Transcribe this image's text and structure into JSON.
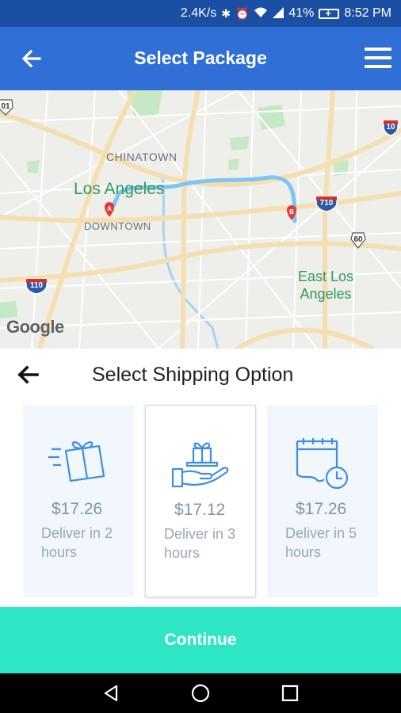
{
  "status_bar": {
    "speed": "2.4K/s",
    "battery_percent": "41%",
    "time": "8:52 PM",
    "icons": [
      "bluetooth-icon",
      "alarm-icon",
      "wifi-icon",
      "signal-icon",
      "battery-charging-icon"
    ]
  },
  "app_bar": {
    "title": "Select Package",
    "back_icon": "arrow-left-icon",
    "menu_icon": "hamburger-menu-icon"
  },
  "map": {
    "labels": {
      "chinatown": "CHINATOWN",
      "los_angeles": "Los Angeles",
      "downtown": "DOWNTOWN",
      "east_la_line1": "East Los",
      "east_la_line2": "Angeles",
      "google": "Google"
    },
    "shields": {
      "i10": "10",
      "i710": "710",
      "r60": "60",
      "i110": "110",
      "us101": "01"
    },
    "markers": {
      "start": "A",
      "end": "B"
    },
    "route_color": "#7ec4f5"
  },
  "shipping": {
    "heading": "Select Shipping Option",
    "selected_index": 1,
    "options": [
      {
        "price": "$17.26",
        "desc": "Deliver in 2 hours",
        "icon": "fast-gift-box-icon"
      },
      {
        "price": "$17.12",
        "desc": "Deliver in 3 hours",
        "icon": "hand-holding-gift-icon"
      },
      {
        "price": "$17.26",
        "desc": "Deliver in 5 hours",
        "icon": "calendar-clock-icon"
      }
    ]
  },
  "continue_label": "Continue",
  "colors": {
    "status_bar": "#1a4fa3",
    "app_bar": "#2f6fd6",
    "continue_button": "#2ee6c4",
    "card_bg": "#f1f7fc",
    "icon_blue": "#3f8fe0"
  }
}
